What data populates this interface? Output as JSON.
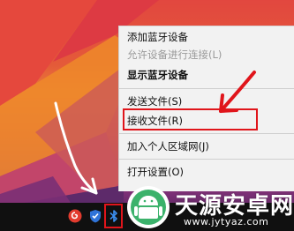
{
  "context_menu": {
    "items": [
      {
        "label": "添加蓝牙设备",
        "state": "normal"
      },
      {
        "label": "允许设备进行连接(L)",
        "state": "disabled"
      },
      {
        "label": "显示蓝牙设备",
        "state": "bold"
      },
      {
        "label": "发送文件(S)",
        "state": "normal"
      },
      {
        "label": "接收文件(R)",
        "state": "normal"
      },
      {
        "label": "加入个人区域网(J)",
        "state": "normal"
      },
      {
        "label": "打开设置(O)",
        "state": "normal"
      }
    ]
  },
  "taskbar": {
    "tray_icons": [
      "netease-music-icon",
      "shield-security-icon",
      "bluetooth-icon"
    ]
  },
  "watermark": {
    "title": "天源安卓网",
    "url": "www.jytyaz.com"
  },
  "annotations": {
    "highlight_color": "#e0151b",
    "arrow_red_color": "#e0151b",
    "arrow_white_color": "#ffffff"
  }
}
